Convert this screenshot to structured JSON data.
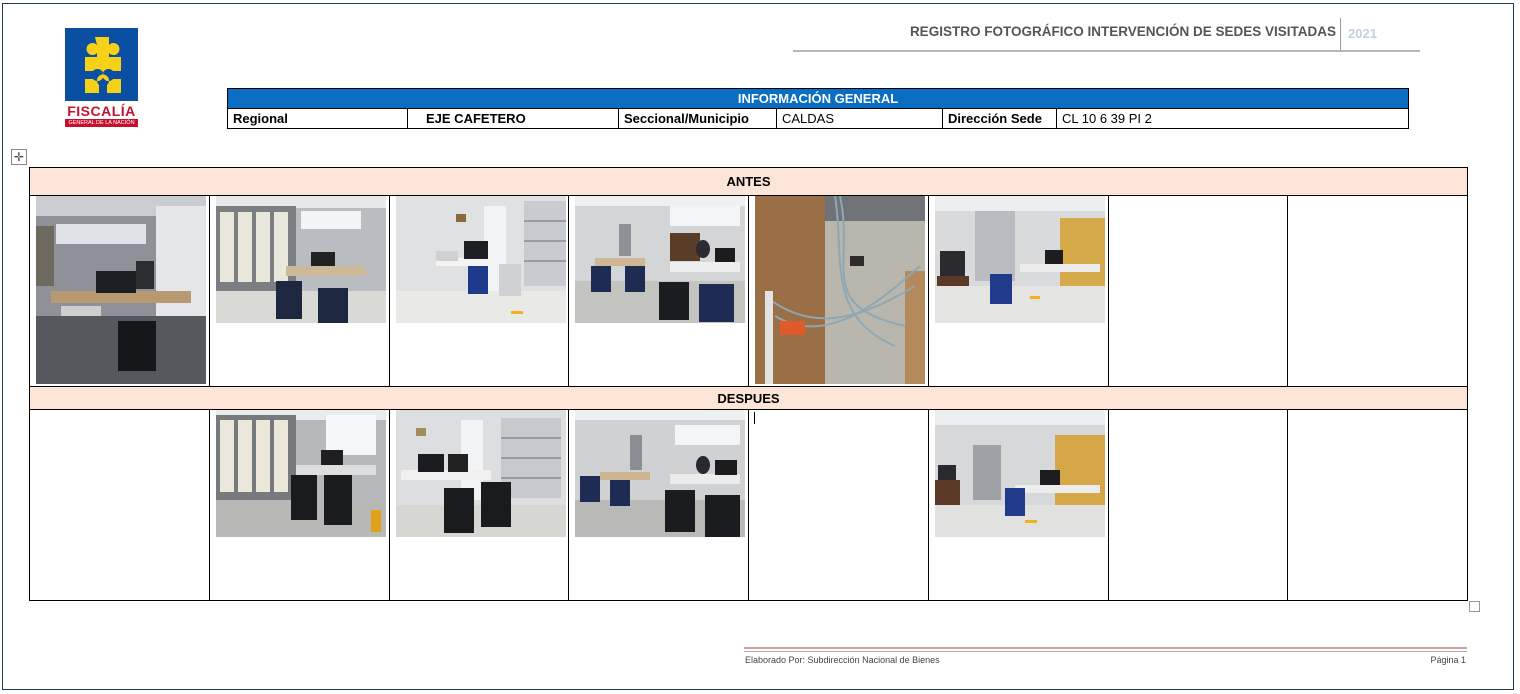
{
  "logo": {
    "name": "FISCALÍA",
    "subtitle": "GENERAL DE LA NACIÓN"
  },
  "header": {
    "title": "REGISTRO FOTOGRÁFICO INTERVENCIÓN DE SEDES VISITADAS",
    "year": "2021"
  },
  "info": {
    "heading": "INFORMACIÓN GENERAL",
    "regional_label": "Regional",
    "regional_value": "EJE CAFETERO",
    "municipio_label": "Seccional/Municipio",
    "municipio_value": "CALDAS",
    "direccion_label": "Dirección Sede",
    "direccion_value": "CL 10 6 39 PI 2"
  },
  "sections": {
    "before": "ANTES",
    "after": "DESPUES"
  },
  "footer": {
    "prepared_by": "Elaborado Por: Subdirección Nacional de Bienes",
    "page": "Página 1"
  },
  "icons": {
    "table_move": "move-handle-icon",
    "table_resize": "resize-handle-icon",
    "logo": "puzzle-piece-icon"
  },
  "colors": {
    "info_header": "#0a6ec2",
    "section_band": "#fce4d6",
    "logo_blue": "#0b4fa3",
    "logo_red": "#c8102e",
    "logo_yellow": "#f7d117"
  }
}
